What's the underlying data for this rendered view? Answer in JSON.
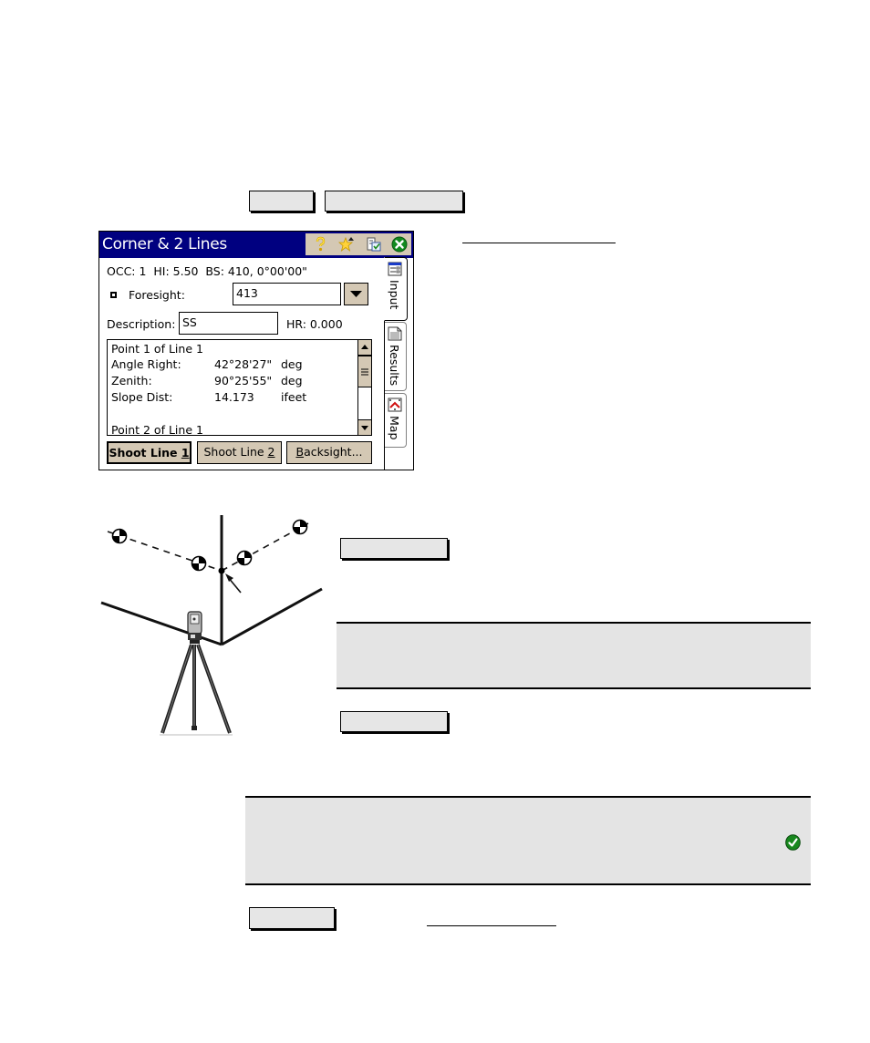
{
  "document": {
    "nav_buttons": [
      {
        "label": ""
      },
      {
        "label": ""
      }
    ],
    "links": [
      {
        "text": ""
      },
      {
        "text": ""
      }
    ],
    "side_buttons": [
      {
        "label": ""
      },
      {
        "label": ""
      }
    ],
    "bottom_button": {
      "label": ""
    },
    "notes": [
      {
        "text": ""
      },
      {
        "text": "",
        "icon": "green-checkmark-icon"
      }
    ]
  },
  "dialog": {
    "title": "Corner & 2 Lines",
    "title_icons": [
      "help-icon",
      "favorites-star-icon",
      "clipboard-check-icon",
      "close-icon"
    ],
    "header_info": "OCC: 1  HI: 5.50  BS: 410, 0°00'00\"",
    "foresight": {
      "label": "Foresight:",
      "value": "413"
    },
    "description": {
      "label": "Description:",
      "value": "SS"
    },
    "hr_label": "HR: 0.000",
    "results_list": [
      {
        "label": "Point 1 of Line 1",
        "value": "",
        "unit": ""
      },
      {
        "label": "Angle Right:",
        "value": "42°28'27\"",
        "unit": "deg"
      },
      {
        "label": "Zenith:",
        "value": "90°25'55\"",
        "unit": "deg"
      },
      {
        "label": "Slope Dist:",
        "value": "14.173",
        "unit": "ifeet"
      },
      {
        "label": "",
        "value": "",
        "unit": ""
      },
      {
        "label": "Point 2 of Line 1",
        "value": "",
        "unit": ""
      }
    ],
    "buttons": [
      {
        "label_prefix": "Shoot Line ",
        "mnemonic": "1",
        "label_suffix": "",
        "default": true
      },
      {
        "label_prefix": "Shoot Line ",
        "mnemonic": "2",
        "label_suffix": "",
        "default": false
      },
      {
        "label_prefix": "",
        "mnemonic": "B",
        "label_suffix": "acksight...",
        "default": false
      }
    ],
    "tabs": [
      {
        "label": "Input",
        "icon": "input-form-icon",
        "active": true
      },
      {
        "label": "Results",
        "icon": "results-sheet-icon",
        "active": false
      },
      {
        "label": "Map",
        "icon": "map-icon",
        "active": false
      }
    ]
  },
  "illustration": {
    "description": "Total station on tripod shooting two lines of prism targets toward a building corner",
    "targets_per_line": 2,
    "lines": 2
  }
}
